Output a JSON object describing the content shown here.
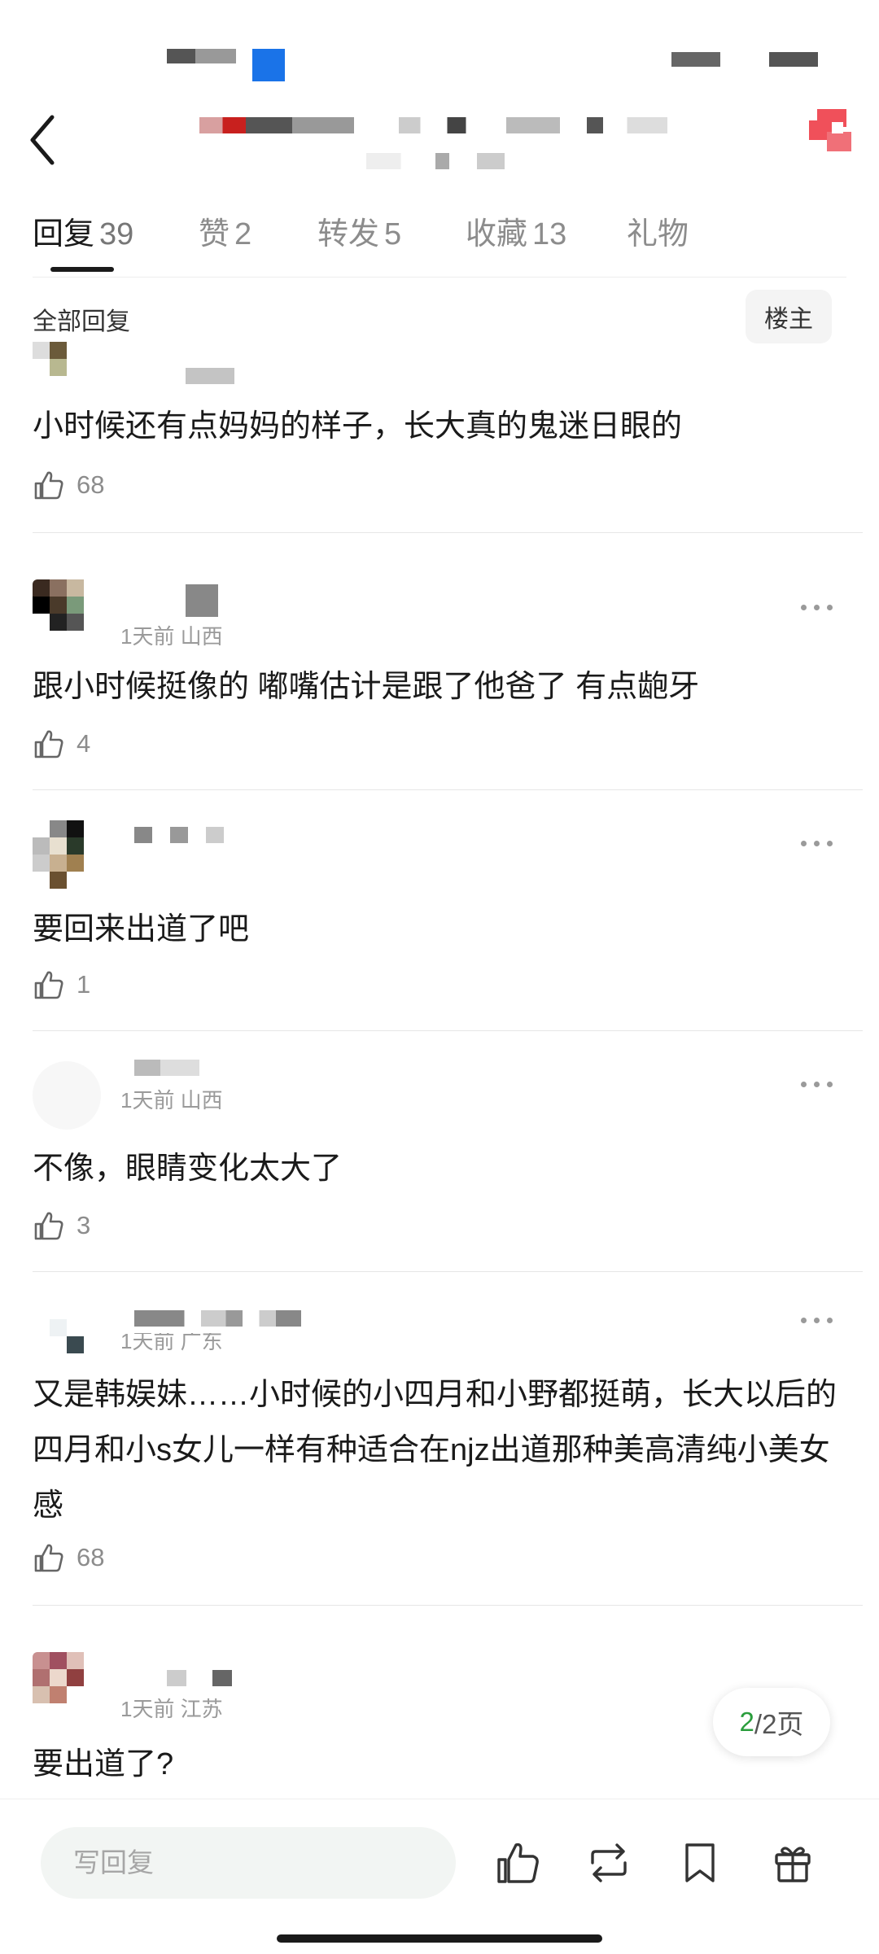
{
  "tabs": [
    {
      "label": "回复",
      "count": "39"
    },
    {
      "label": "赞",
      "count": "2"
    },
    {
      "label": "转发",
      "count": "5"
    },
    {
      "label": "收藏",
      "count": "13"
    },
    {
      "label": "礼物",
      "count": ""
    }
  ],
  "section_title": "全部回复",
  "op_button": "楼主",
  "comments": [
    {
      "meta": "",
      "text": "小时候还有点妈妈的样子，长大真的鬼迷日眼的",
      "likes": "68"
    },
    {
      "meta": "1天前 山西",
      "text": "跟小时候挺像的 嘟嘴估计是跟了他爸了 有点龅牙",
      "likes": "4"
    },
    {
      "meta": "",
      "text": "要回来出道了吧",
      "likes": "1"
    },
    {
      "meta": "1天前 山西",
      "text": "不像，眼睛变化太大了",
      "likes": "3"
    },
    {
      "meta": "1天前 广东",
      "text": "又是韩娱妹……小时候的小四月和小野都挺萌，长大以后的四月和小s女儿一样有种适合在njz出道那种美高清纯小美女感",
      "likes": "68"
    },
    {
      "meta": "1天前 江苏",
      "text": "要出道了?",
      "likes": ""
    }
  ],
  "pagination": {
    "current": "2",
    "total_label": "/2页"
  },
  "reply_placeholder": "写回复",
  "icons": [
    "back-icon",
    "share-icon",
    "thumbs-up-icon",
    "repost-icon",
    "bookmark-icon",
    "gift-icon",
    "more-icon"
  ],
  "colors": {
    "accent_green": "#2a9d3c",
    "share_red": "#f0505a",
    "text": "#1a1a1a",
    "muted": "#8c8c8c"
  }
}
